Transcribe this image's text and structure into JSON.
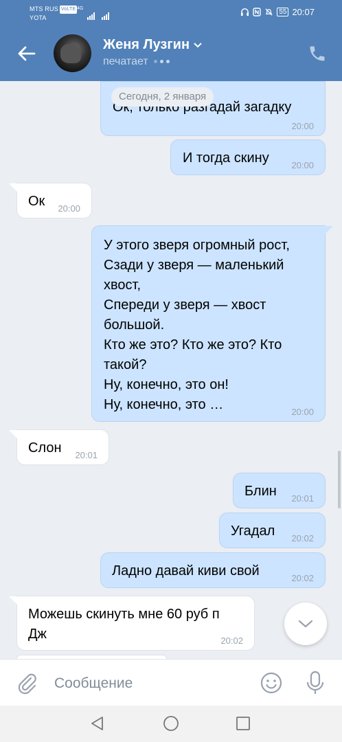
{
  "status_bar": {
    "carrier1": "MTS RUS",
    "volte": "VoLTE",
    "carrier2": "YOTA",
    "network": "4G",
    "battery": "55",
    "time": "20:07"
  },
  "header": {
    "name": "Женя Лузгин",
    "status": "печатает"
  },
  "date_separator": "Сегодня, 2 января",
  "messages": [
    {
      "dir": "out",
      "text": "Ок, только разгадай загадку",
      "time": "20:00"
    },
    {
      "dir": "out",
      "text": "И тогда скину",
      "time": "20:00"
    },
    {
      "dir": "in",
      "text": "Ок",
      "time": "20:00"
    },
    {
      "dir": "out",
      "lines": [
        "У этого зверя огромный рост,",
        "Сзади у зверя — маленький",
        "хвост,",
        "Спереди у зверя — хвост",
        "большой.",
        "Кто же это? Кто же это? Кто",
        "такой?",
        "Ну, конечно, это он!",
        "Ну, конечно, это …"
      ],
      "time": "20:00"
    },
    {
      "dir": "in",
      "text": "Слон",
      "time": "20:01"
    },
    {
      "dir": "out",
      "text": "Блин",
      "time": "20:01"
    },
    {
      "dir": "out",
      "text": "Угадал",
      "time": "20:02"
    },
    {
      "dir": "out",
      "text": "Ладно давай киви свой",
      "time": "20:02"
    },
    {
      "dir": "in",
      "lines": [
        "Можешь скинуть мне 60 руб п",
        "Дж"
      ],
      "time": "20:02"
    }
  ],
  "composer": {
    "placeholder": "Сообщение"
  },
  "colors": {
    "header_bg": "#5181b8",
    "out_bubble": "#cce4ff",
    "in_bubble": "#ffffff",
    "chat_bg": "#ebeef2"
  }
}
